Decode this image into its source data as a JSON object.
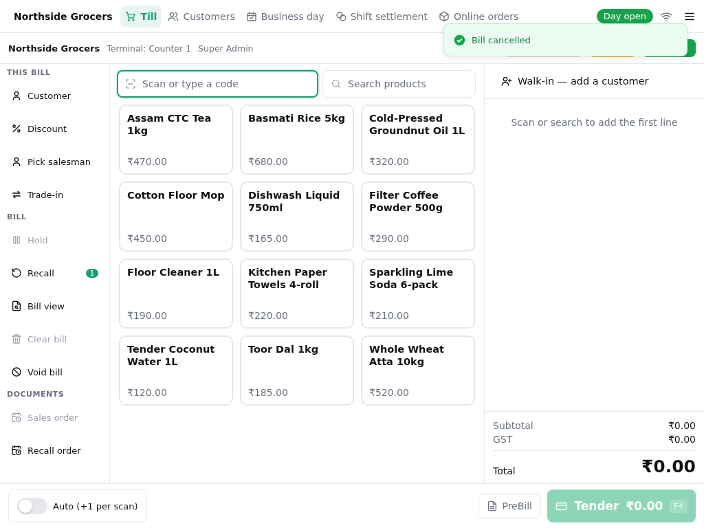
{
  "nav": {
    "brand": "Northside Grocers",
    "tabs": [
      {
        "label": "Till",
        "selected": true
      },
      {
        "label": "Customers",
        "selected": false
      },
      {
        "label": "Business day",
        "selected": false
      },
      {
        "label": "Shift settlement",
        "selected": false
      },
      {
        "label": "Online orders",
        "selected": false
      }
    ],
    "day_status": "Day open"
  },
  "info_bar": {
    "store": "Northside Grocers",
    "terminal": "Terminal: Counter 1",
    "user": "Super Admin"
  },
  "toast": {
    "message": "Bill cancelled"
  },
  "sidebar": {
    "sections": [
      {
        "title": "THIS BILL",
        "items": [
          {
            "label": "Customer",
            "disabled": false
          },
          {
            "label": "Discount",
            "disabled": false
          },
          {
            "label": "Pick salesman",
            "disabled": false
          },
          {
            "label": "Trade-in",
            "disabled": false
          }
        ]
      },
      {
        "title": "BILL",
        "items": [
          {
            "label": "Hold",
            "disabled": true
          },
          {
            "label": "Recall",
            "disabled": false,
            "badge": "1"
          },
          {
            "label": "Bill view",
            "disabled": false
          },
          {
            "label": "Clear bill",
            "disabled": true
          },
          {
            "label": "Void bill",
            "disabled": false
          }
        ]
      },
      {
        "title": "DOCUMENTS",
        "items": [
          {
            "label": "Sales order",
            "disabled": true
          },
          {
            "label": "Recall order",
            "disabled": false
          }
        ]
      }
    ]
  },
  "scan_field": {
    "placeholder": "Scan or type a code",
    "focused": true
  },
  "search_field": {
    "placeholder": "Search products"
  },
  "products": [
    {
      "name": "Assam CTC Tea 1kg",
      "price": "₹470.00"
    },
    {
      "name": "Basmati Rice 5kg",
      "price": "₹680.00"
    },
    {
      "name": "Cold-Pressed Groundnut Oil 1L",
      "price": "₹320.00"
    },
    {
      "name": "Cotton Floor Mop",
      "price": "₹450.00"
    },
    {
      "name": "Dishwash Liquid 750ml",
      "price": "₹165.00"
    },
    {
      "name": "Filter Coffee Powder 500g",
      "price": "₹290.00"
    },
    {
      "name": "Floor Cleaner 1L",
      "price": "₹190.00"
    },
    {
      "name": "Kitchen Paper Towels 4-roll",
      "price": "₹220.00"
    },
    {
      "name": "Sparkling Lime Soda 6-pack",
      "price": "₹210.00"
    },
    {
      "name": "Tender Coconut Water 1L",
      "price": "₹120.00"
    },
    {
      "name": "Toor Dal 1kg",
      "price": "₹185.00"
    },
    {
      "name": "Whole Wheat Atta 10kg",
      "price": "₹520.00"
    }
  ],
  "cart": {
    "customer_action": "Walk-in — add a customer",
    "empty_message": "Scan or search to add the first line",
    "subtotal_label": "Subtotal",
    "subtotal": "₹0.00",
    "gst_label": "GST",
    "gst": "₹0.00",
    "total_label": "Total",
    "total": "₹0.00"
  },
  "footer": {
    "auto_toggle": {
      "label": "Auto (+1 per scan)",
      "on": false
    },
    "prebill": "PreBill",
    "tender": {
      "label": "Tender",
      "amount": "₹0.00",
      "shortcut": "F4",
      "disabled": true
    }
  }
}
